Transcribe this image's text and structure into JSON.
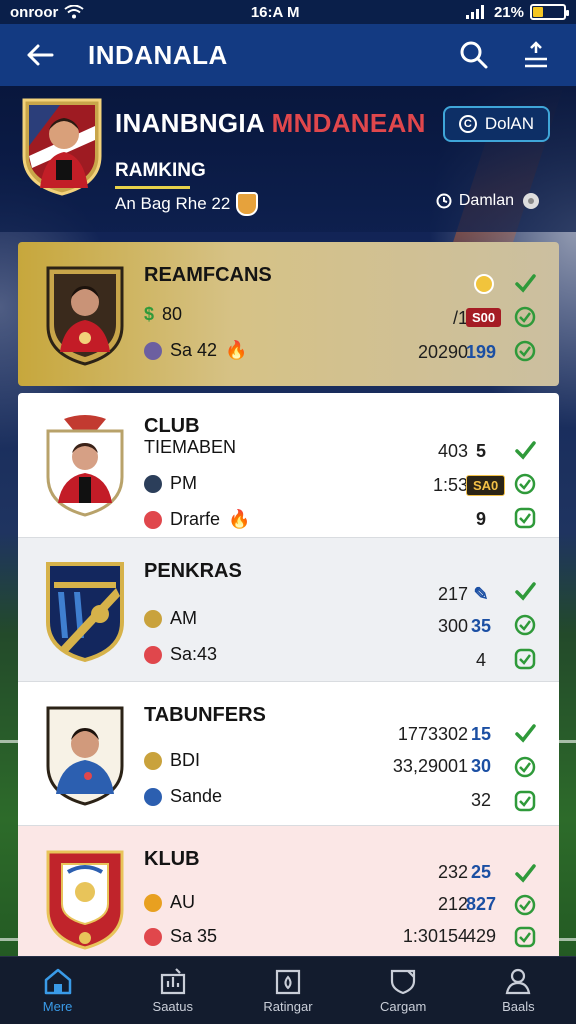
{
  "status_bar": {
    "carrier": "onroor",
    "time": "16:A M",
    "battery": "21%"
  },
  "app_bar": {
    "title": "INDANALA"
  },
  "profile": {
    "name_main": "INANBNGIA",
    "name_accent": "MNDANEAN",
    "subtitle": "RAMKING",
    "meta": "An Bag Rhe 22",
    "pill_label": "DolAN",
    "side_label": "Damlan"
  },
  "cards": [
    {
      "title": "REAMFCANS",
      "row1": "80",
      "row2": "Sa 42",
      "c1": "",
      "c2": "/1",
      "c3": "20290",
      "s2tag": "S00",
      "s3": "199"
    },
    {
      "title": "CLUB",
      "subtitle": "TIEMABEN",
      "row1": "PM",
      "row2": "Drarfe",
      "c1": "403",
      "c2": "1:53",
      "s1": "5",
      "s2tag": "SA0",
      "s3": "9"
    },
    {
      "title": "PENKRAS",
      "row1": "AM",
      "row2": "Sa:43",
      "c1": "217",
      "c2": "300",
      "s2": "35",
      "s3": "4"
    },
    {
      "title": "TABUNFERS",
      "row1": "BDI",
      "row2": "Sande",
      "c1": "1773302",
      "c2": "33,29001",
      "s1": "15",
      "s2": "30",
      "s3": "32"
    },
    {
      "title": "KLUB",
      "row1": "AU",
      "row2": "Sa 35",
      "c1": "232",
      "c2": "212",
      "c3": "1:30154",
      "s1": "25",
      "s2": "827",
      "s3": "429"
    }
  ],
  "nav": [
    {
      "label": "Mere",
      "icon": "home-icon"
    },
    {
      "label": "Saatus",
      "icon": "stats-icon"
    },
    {
      "label": "Ratingar",
      "icon": "rating-icon"
    },
    {
      "label": "Cargam",
      "icon": "shield-icon"
    },
    {
      "label": "Baals",
      "icon": "profile-icon"
    }
  ],
  "colors": {
    "app_bar": "#133a82",
    "accent_red": "#e0474c",
    "check_green": "#2f9a3a",
    "nav_active": "#3a9be8"
  }
}
